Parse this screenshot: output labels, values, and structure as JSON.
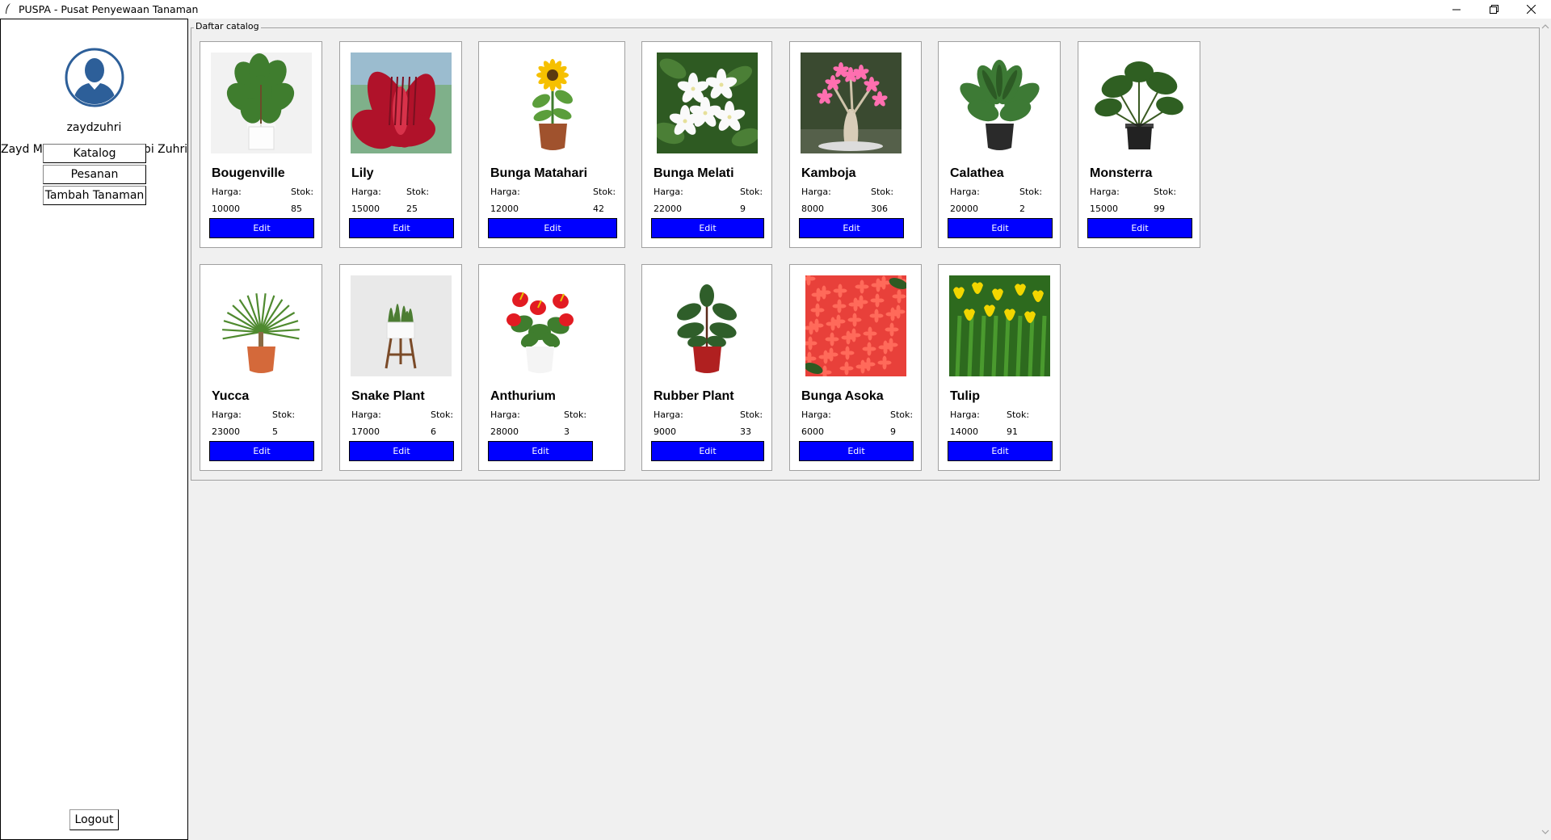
{
  "window": {
    "title": "PUSPA - Pusat Penyewaan Tanaman"
  },
  "sidebar": {
    "username": "zaydzuhri",
    "fullname": "Zayd Muhammad Kawakibi Zuhri",
    "nav": {
      "katalog": "Katalog",
      "pesanan": "Pesanan",
      "tambah": "Tambah Tanaman"
    },
    "logout": "Logout"
  },
  "catalog": {
    "title": "Daftar catalog",
    "price_label": "Harga:",
    "stock_label": "Stok:",
    "edit_label": "Edit",
    "items": [
      {
        "name": "Bougenville",
        "price": "10000",
        "stock": "85",
        "image": "potted-fiddle-leaf-plant"
      },
      {
        "name": "Lily",
        "price": "15000",
        "stock": "25",
        "image": "red-lily-flower"
      },
      {
        "name": "Bunga Matahari",
        "price": "12000",
        "stock": "42",
        "image": "potted-sunflower"
      },
      {
        "name": "Bunga Melati",
        "price": "22000",
        "stock": "9",
        "image": "white-jasmine-flowers"
      },
      {
        "name": "Kamboja",
        "price": "8000",
        "stock": "306",
        "image": "pink-adenium-bonsai"
      },
      {
        "name": "Calathea",
        "price": "20000",
        "stock": "2",
        "image": "potted-calathea"
      },
      {
        "name": "Monsterra",
        "price": "15000",
        "stock": "99",
        "image": "potted-monstera"
      },
      {
        "name": "Yucca",
        "price": "23000",
        "stock": "5",
        "image": "potted-yucca"
      },
      {
        "name": "Snake Plant",
        "price": "17000",
        "stock": "6",
        "image": "snake-plant-on-stand"
      },
      {
        "name": "Anthurium",
        "price": "28000",
        "stock": "3",
        "image": "red-anthurium"
      },
      {
        "name": "Rubber Plant",
        "price": "9000",
        "stock": "33",
        "image": "potted-rubber-plant"
      },
      {
        "name": "Bunga Asoka",
        "price": "6000",
        "stock": "9",
        "image": "red-ixora-flowers"
      },
      {
        "name": "Tulip",
        "price": "14000",
        "stock": "91",
        "image": "yellow-tulips"
      }
    ]
  },
  "colors": {
    "edit_button": "#0000ff",
    "avatar": "#2d5f99"
  }
}
